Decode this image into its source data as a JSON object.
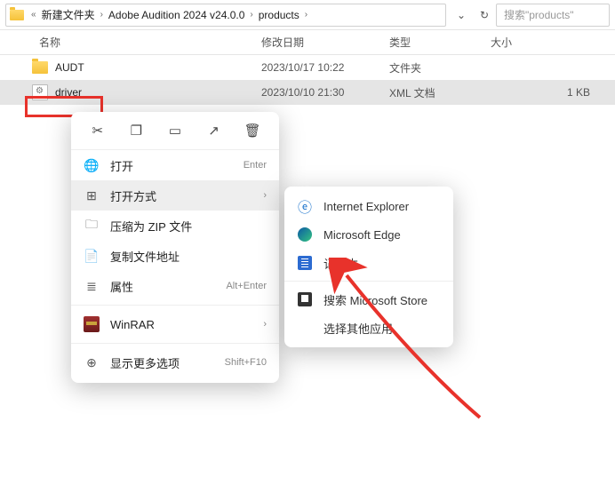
{
  "breadcrumbs": {
    "prefix": "«",
    "items": [
      "新建文件夹",
      "Adobe Audition 2024 v24.0.0",
      "products"
    ]
  },
  "search": {
    "placeholder": "搜索\"products\""
  },
  "columns": {
    "name": "名称",
    "date": "修改日期",
    "type": "类型",
    "size": "大小"
  },
  "files": [
    {
      "name": "AUDT",
      "date": "2023/10/17 10:22",
      "type": "文件夹",
      "size": "",
      "icon": "folder"
    },
    {
      "name": "driver",
      "date": "2023/10/10 21:30",
      "type": "XML 文档",
      "size": "1 KB",
      "icon": "xml"
    }
  ],
  "context_menu": {
    "open": {
      "label": "打开",
      "accel": "Enter"
    },
    "open_with": {
      "label": "打开方式"
    },
    "zip": {
      "label": "压缩为 ZIP 文件"
    },
    "copy_path": {
      "label": "复制文件地址"
    },
    "properties": {
      "label": "属性",
      "accel": "Alt+Enter"
    },
    "winrar": {
      "label": "WinRAR"
    },
    "more": {
      "label": "显示更多选项",
      "accel": "Shift+F10"
    }
  },
  "submenu": {
    "ie": {
      "label": "Internet Explorer"
    },
    "edge": {
      "label": "Microsoft Edge"
    },
    "notepad": {
      "label": "记事本"
    },
    "store": {
      "label": "搜索 Microsoft Store"
    },
    "other": {
      "label": "选择其他应用"
    }
  }
}
